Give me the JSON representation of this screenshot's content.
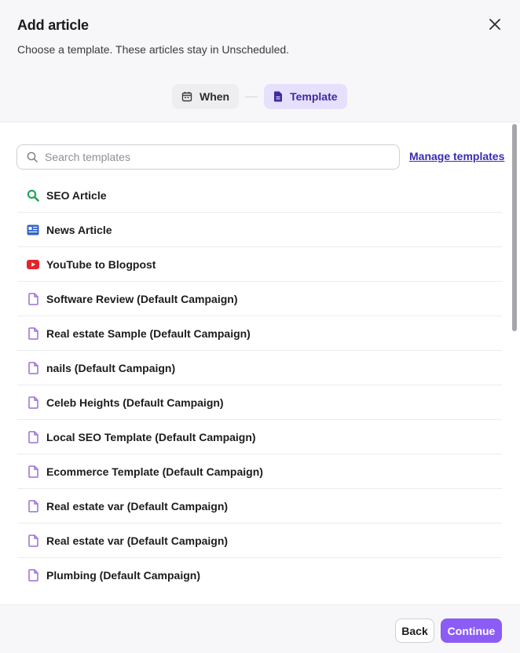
{
  "dialog": {
    "title": "Add article",
    "subtitle": "Choose a template. These articles stay in Unscheduled."
  },
  "steps": [
    {
      "label": "When",
      "icon": "calendar-icon",
      "active": false
    },
    {
      "label": "Template",
      "icon": "document-icon",
      "active": true
    }
  ],
  "search": {
    "placeholder": "Search templates",
    "value": ""
  },
  "manage_templates_label": "Manage templates",
  "templates": [
    {
      "label": "SEO Article",
      "icon": "search-icon",
      "icon_color": "#22a559"
    },
    {
      "label": "News Article",
      "icon": "newspaper-icon",
      "icon_color": "#2f62c9"
    },
    {
      "label": "YouTube to Blogpost",
      "icon": "youtube-icon",
      "icon_color": "#e0262b"
    },
    {
      "label": "Software Review (Default Campaign)",
      "icon": "document-icon",
      "icon_color": "#9b6fd9"
    },
    {
      "label": "Real estate Sample (Default Campaign)",
      "icon": "document-icon",
      "icon_color": "#9b6fd9"
    },
    {
      "label": "nails (Default Campaign)",
      "icon": "document-icon",
      "icon_color": "#9b6fd9"
    },
    {
      "label": "Celeb Heights (Default Campaign)",
      "icon": "document-icon",
      "icon_color": "#9b6fd9"
    },
    {
      "label": "Local SEO Template (Default Campaign)",
      "icon": "document-icon",
      "icon_color": "#9b6fd9"
    },
    {
      "label": "Ecommerce Template (Default Campaign)",
      "icon": "document-icon",
      "icon_color": "#9b6fd9"
    },
    {
      "label": "Real estate var (Default Campaign)",
      "icon": "document-icon",
      "icon_color": "#9b6fd9"
    },
    {
      "label": "Real estate var (Default Campaign)",
      "icon": "document-icon",
      "icon_color": "#9b6fd9"
    },
    {
      "label": "Plumbing (Default Campaign)",
      "icon": "document-icon",
      "icon_color": "#9b6fd9"
    }
  ],
  "footer": {
    "back_label": "Back",
    "continue_label": "Continue"
  },
  "colors": {
    "accent": "#8b5cf6",
    "active_step_bg": "#e6e0fc",
    "link": "#3a2bb5"
  }
}
